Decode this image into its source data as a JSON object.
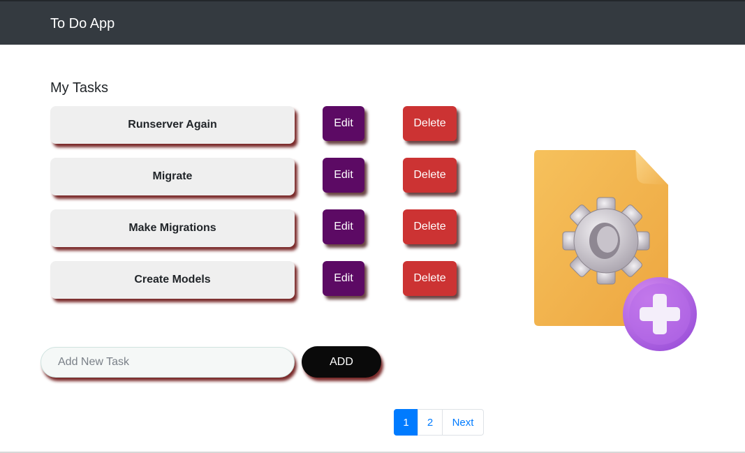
{
  "navbar": {
    "brand": "To Do App"
  },
  "main": {
    "title": "My Tasks",
    "tasks": [
      {
        "name": "Runserver Again",
        "edit_label": "Edit",
        "delete_label": "Delete"
      },
      {
        "name": "Migrate",
        "edit_label": "Edit",
        "delete_label": "Delete"
      },
      {
        "name": "Make Migrations",
        "edit_label": "Edit",
        "delete_label": "Delete"
      },
      {
        "name": "Create Models",
        "edit_label": "Edit",
        "delete_label": "Delete"
      }
    ],
    "add_form": {
      "placeholder": "Add New Task",
      "value": "",
      "button_label": "ADD"
    },
    "pagination": {
      "pages": [
        "1",
        "2"
      ],
      "active": "1",
      "next_label": "Next"
    }
  },
  "illustration": {
    "icon": "document-gear-add-icon"
  },
  "colors": {
    "navbar": "#343a40",
    "edit_button": "#5c0a64",
    "delete_button": "#cc3333",
    "add_button": "#0a0a0a",
    "pagination_active": "#007bff"
  }
}
